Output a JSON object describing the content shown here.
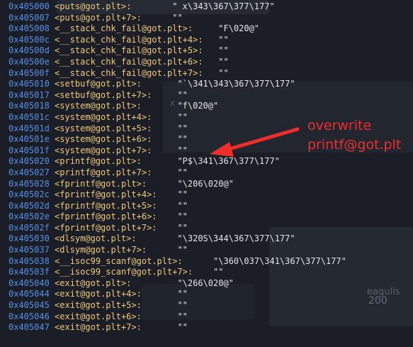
{
  "rows": [
    {
      "addr": "0x405000",
      "sym": "<puts@got.plt>:",
      "pad": "        ",
      "val": "\" x\\343\\367\\377\\177\""
    },
    {
      "addr": "0x405007",
      "sym": "<puts@got.plt+7>:",
      "pad": "      ",
      "val": "\"\""
    },
    {
      "addr": "0x405008",
      "sym": "<__stack_chk_fail@got.plt>:",
      "pad": "     ",
      "val": "\"F\\020@\""
    },
    {
      "addr": "0x40500c",
      "sym": "<__stack_chk_fail@got.plt+4>:",
      "pad": "   ",
      "val": "\"\""
    },
    {
      "addr": "0x40500d",
      "sym": "<__stack_chk_fail@got.plt+5>:",
      "pad": "   ",
      "val": "\"\""
    },
    {
      "addr": "0x40500e",
      "sym": "<__stack_chk_fail@got.plt+6>:",
      "pad": "   ",
      "val": "\"\""
    },
    {
      "addr": "0x40500f",
      "sym": "<__stack_chk_fail@got.plt+7>:",
      "pad": "   ",
      "val": "\"\""
    },
    {
      "addr": "0x405010",
      "sym": "<setbuf@got.plt>:",
      "pad": "       ",
      "val": "\"`\\341\\343\\367\\377\\177\""
    },
    {
      "addr": "0x405017",
      "sym": "<setbuf@got.plt+7>:",
      "pad": "     ",
      "val": "\"\""
    },
    {
      "addr": "0x405018",
      "sym": "<system@got.plt>:",
      "pad": "       ",
      "val": "\"f\\020@\""
    },
    {
      "addr": "0x40501c",
      "sym": "<system@got.plt+4>:",
      "pad": "     ",
      "val": "\"\""
    },
    {
      "addr": "0x40501d",
      "sym": "<system@got.plt+5>:",
      "pad": "     ",
      "val": "\"\""
    },
    {
      "addr": "0x40501e",
      "sym": "<system@got.plt+6>:",
      "pad": "     ",
      "val": "\"\""
    },
    {
      "addr": "0x40501f",
      "sym": "<system@got.plt+7>:",
      "pad": "     ",
      "val": "\"\""
    },
    {
      "addr": "0x405020",
      "sym": "<printf@got.plt>:",
      "pad": "       ",
      "val": "\"P$\\341\\367\\377\\177\""
    },
    {
      "addr": "0x405027",
      "sym": "<printf@got.plt+7>:",
      "pad": "     ",
      "val": "\"\""
    },
    {
      "addr": "0x405028",
      "sym": "<fprintf@got.plt>:",
      "pad": "      ",
      "val": "\"\\206\\020@\""
    },
    {
      "addr": "0x40502c",
      "sym": "<fprintf@got.plt+4>:",
      "pad": "    ",
      "val": "\"\""
    },
    {
      "addr": "0x40502d",
      "sym": "<fprintf@got.plt+5>:",
      "pad": "    ",
      "val": "\"\""
    },
    {
      "addr": "0x40502e",
      "sym": "<fprintf@got.plt+6>:",
      "pad": "    ",
      "val": "\"\""
    },
    {
      "addr": "0x40502f",
      "sym": "<fprintf@got.plt+7>:",
      "pad": "    ",
      "val": "\"\""
    },
    {
      "addr": "0x405030",
      "sym": "<dlsym@got.plt>:",
      "pad": "        ",
      "val": "\"\\320S\\344\\367\\377\\177\""
    },
    {
      "addr": "0x405037",
      "sym": "<dlsym@got.plt+7>:",
      "pad": "      ",
      "val": "\"\""
    },
    {
      "addr": "0x405038",
      "sym": "<__isoc99_scanf@got.plt>:",
      "pad": "      ",
      "val": "\"\\360\\037\\341\\367\\377\\177\""
    },
    {
      "addr": "0x40503f",
      "sym": "<__isoc99_scanf@got.plt+7>:",
      "pad": "    ",
      "val": "\"\""
    },
    {
      "addr": "0x405040",
      "sym": "<exit@got.plt>:",
      "pad": "         ",
      "val": "\"\\266\\020@\""
    },
    {
      "addr": "0x405044",
      "sym": "<exit@got.plt+4>:",
      "pad": "       ",
      "val": "\"\""
    },
    {
      "addr": "0x405045",
      "sym": "<exit@got.plt+5>:",
      "pad": "       ",
      "val": "\"\""
    },
    {
      "addr": "0x405046",
      "sym": "<exit@got.plt+6>:",
      "pad": "       ",
      "val": "\"\""
    },
    {
      "addr": "0x405047",
      "sym": "<exit@got.plt+7>:",
      "pad": "       ",
      "val": "\"\""
    }
  ],
  "annotation": {
    "line1": "overwrite",
    "line2": "printf@got.plt"
  },
  "background": {
    "label_a": "eagulls",
    "label_b": "200",
    "label_c": "x"
  },
  "colors": {
    "address": "#5591e8",
    "symbol": "#f0c97a",
    "value": "#e6e6e6",
    "annotation": "#ee2d2d",
    "background": "#1b1e27"
  },
  "icons": [
    "arrow-annotation-icon"
  ]
}
